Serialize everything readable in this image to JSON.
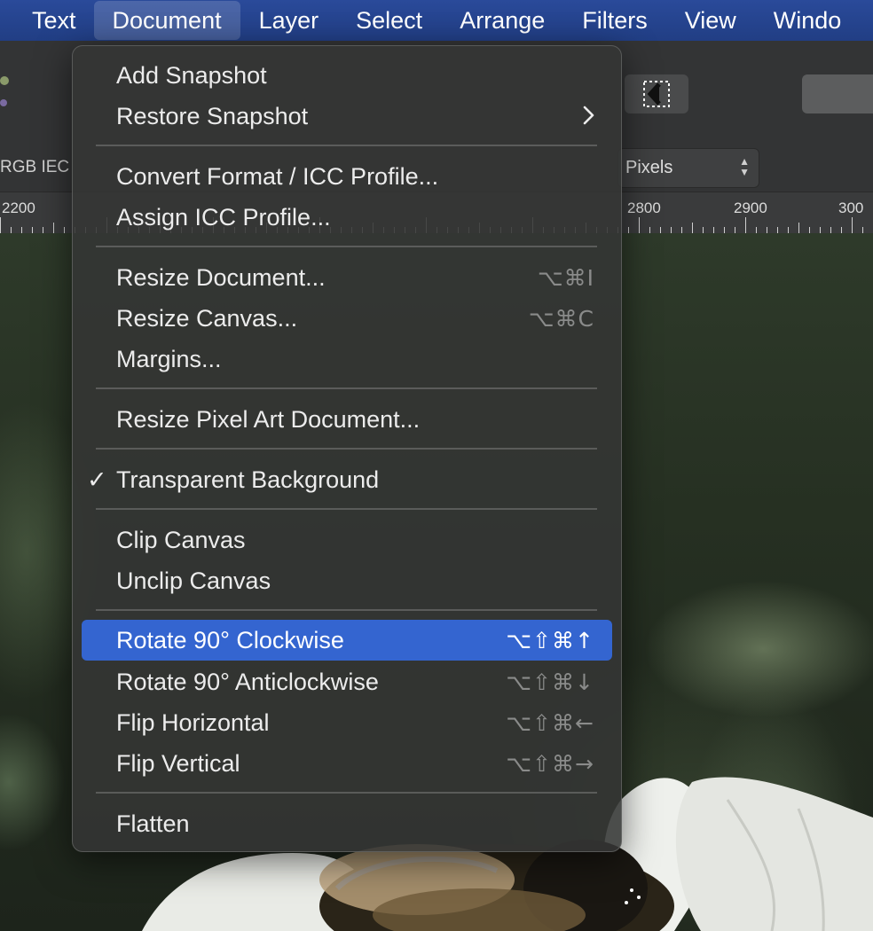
{
  "menubar": {
    "items": [
      "Text",
      "Document",
      "Layer",
      "Select",
      "Arrange",
      "Filters",
      "View",
      "Windo"
    ],
    "active": "Document"
  },
  "toolbar": {
    "color_profile": "RGB IEC",
    "units_value": "Pixels"
  },
  "ruler": {
    "labels": [
      "2200",
      "2800",
      "2900",
      "300"
    ]
  },
  "document_menu": {
    "add_snapshot": "Add Snapshot",
    "restore_snapshot": "Restore Snapshot",
    "convert_format": "Convert Format / ICC Profile...",
    "assign_icc": "Assign ICC Profile...",
    "resize_document": "Resize Document...",
    "resize_document_shortcut": "⌥⌘I",
    "resize_canvas": "Resize Canvas...",
    "resize_canvas_shortcut": "⌥⌘C",
    "margins": "Margins...",
    "resize_pixel_art": "Resize Pixel Art Document...",
    "transparent_background": "Transparent Background",
    "transparent_checked": "✓",
    "clip_canvas": "Clip Canvas",
    "unclip_canvas": "Unclip Canvas",
    "rotate_cw": "Rotate 90° Clockwise",
    "rotate_cw_shortcut": "⌥⇧⌘↑",
    "rotate_acw": "Rotate 90° Anticlockwise",
    "rotate_acw_shortcut": "⌥⇧⌘↓",
    "flip_h": "Flip Horizontal",
    "flip_h_shortcut": "⌥⇧⌘←",
    "flip_v": "Flip Vertical",
    "flip_v_shortcut": "⌥⇧⌘→",
    "flatten": "Flatten"
  },
  "colors": {
    "menubar_bg": "#213e84",
    "highlight": "#3465d0",
    "menu_bg": "#343634"
  }
}
